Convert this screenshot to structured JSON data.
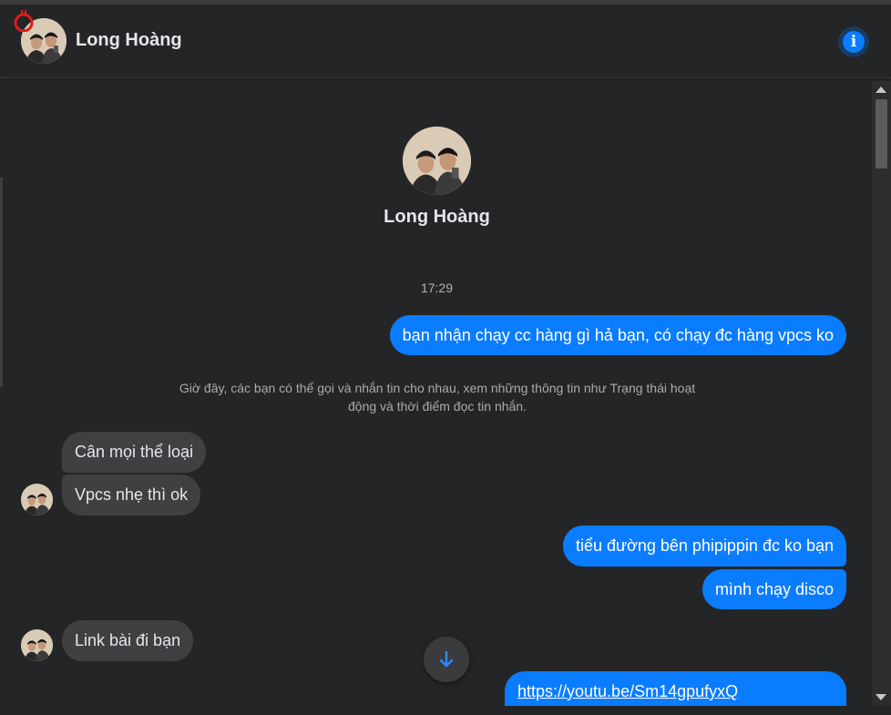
{
  "header": {
    "contact_name": "Long Hoàng",
    "info_icon": "info-icon"
  },
  "profile": {
    "name": "Long Hoàng"
  },
  "conversation": {
    "timestamp": "17:29",
    "system_note": "Giờ đây, các bạn có thể gọi và nhắn tin cho nhau, xem những thông tin như Trạng thái hoạt động và thời điểm đọc tin nhắn.",
    "messages": [
      {
        "direction": "outgoing",
        "text": "bạn nhận chạy cc hàng gì hả bạn, có chạy đc hàng vpcs ko"
      },
      {
        "direction": "incoming",
        "text": "Cân mọi thể loại"
      },
      {
        "direction": "incoming",
        "text": "Vpcs nhẹ thì ok"
      },
      {
        "direction": "outgoing",
        "text": "tiểu đường bên phipippin đc ko bạn"
      },
      {
        "direction": "outgoing",
        "text": "mình chạy disco"
      },
      {
        "direction": "incoming",
        "text": "Link bài đi bạn"
      },
      {
        "direction": "outgoing",
        "text": "https://youtu.be/Sm14gpufyxQ"
      }
    ]
  },
  "colors": {
    "background": "#242526",
    "outgoing_bubble": "#0a7cff",
    "incoming_bubble": "#3e4042",
    "accent": "#0a7cff"
  }
}
